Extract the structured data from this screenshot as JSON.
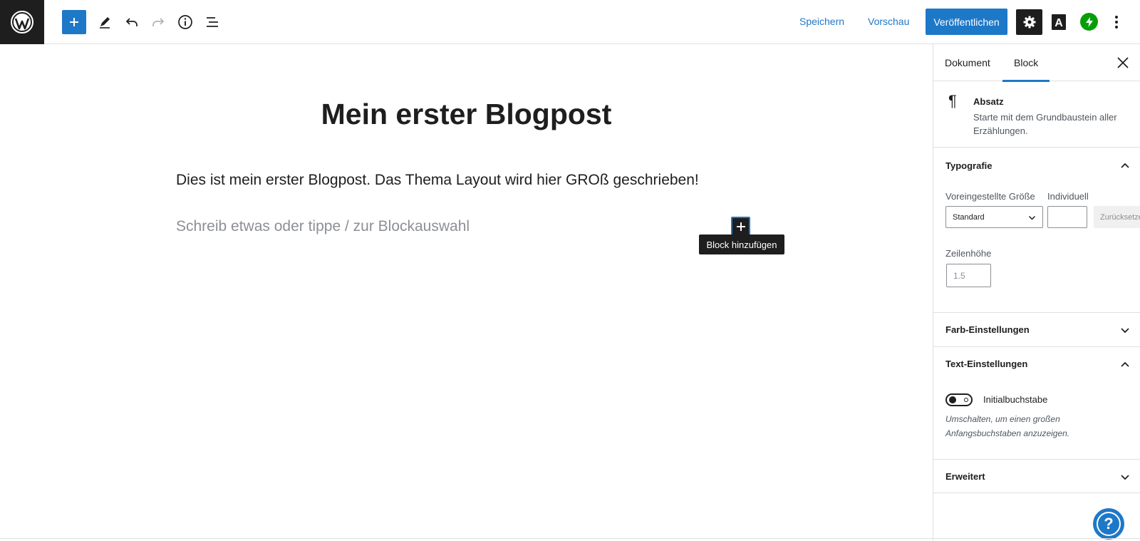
{
  "toolbar": {
    "save_label": "Speichern",
    "preview_label": "Vorschau",
    "publish_label": "Veröffentlichen",
    "a_label": "A",
    "icons": [
      "wordpress-logo",
      "plus",
      "pencil",
      "undo",
      "redo",
      "info",
      "list-view",
      "gear",
      "a-letter",
      "jetpack-bolt",
      "more-vertical"
    ]
  },
  "editor": {
    "title": "Mein erster Blogpost",
    "paragraph": "Dies ist mein erster Blogpost. Das Thema Layout wird hier GROß geschrieben!",
    "placeholder": "Schreib etwas oder tippe / zur Blockauswahl",
    "inserter_tooltip": "Block hinzufügen"
  },
  "sidebar": {
    "tabs": [
      "Dokument",
      "Block"
    ],
    "active_tab": "Block",
    "block": {
      "name": "Absatz",
      "description": "Starte mit dem Grundbaustein aller Erzählungen.",
      "icon": "¶"
    },
    "typography": {
      "title": "Typografie",
      "preset_label": "Voreingestellte Größe",
      "custom_label": "Individuell",
      "preset_value": "Standard",
      "custom_value": "",
      "reset_label": "Zurücksetzen",
      "line_height_label": "Zeilenhöhe",
      "line_height_placeholder": "1.5"
    },
    "color_panel": {
      "title": "Farb-Einstellungen"
    },
    "text_panel": {
      "title": "Text-Einstellungen",
      "toggle_label": "Initialbuchstabe",
      "toggle_on": false,
      "help": "Umschalten, um einen großen Anfangsbuchstaben anzuzeigen."
    },
    "advanced_panel": {
      "title": "Erweitert"
    }
  },
  "help_bubble": {
    "label": "?"
  },
  "colors": {
    "accent": "#1e78c8",
    "dark": "#1e1e1e",
    "jetpack": "#069e08",
    "muted": "#50575e"
  }
}
